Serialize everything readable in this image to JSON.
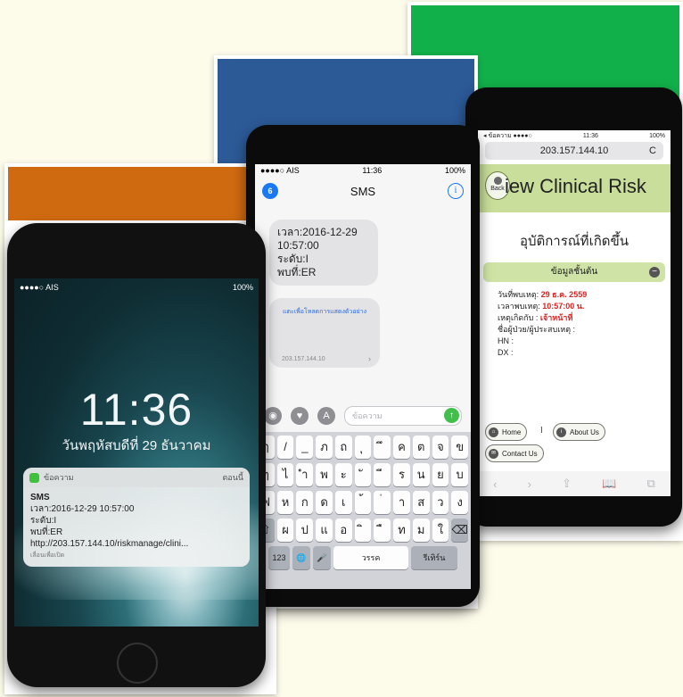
{
  "lock_phone": {
    "status": {
      "carrier": "●●●●○ AIS",
      "battery": "100%"
    },
    "time": "11:36",
    "date": "วันพฤหัสบดีที่ 29 ธันวาคม",
    "notification": {
      "app": "ข้อความ",
      "when": "ตอนนี้",
      "title": "SMS",
      "lines": [
        "เวลา:2016-12-29 10:57:00",
        "ระดับ:I",
        "พบที่:ER",
        "http://203.157.144.10/riskmanage/clini..."
      ],
      "hint": "เลื่อนเพื่อเปิด"
    }
  },
  "sms_phone": {
    "status": {
      "carrier": "●●●●○ AIS",
      "time": "11:36",
      "battery": "100%"
    },
    "nav": {
      "back_count": "6",
      "title": "SMS",
      "info": "i"
    },
    "message_lines": [
      "เวลา:2016-12-29",
      "10:57:00",
      "ระดับ:I",
      "พบที่:ER"
    ],
    "link_preview": {
      "text": "แตะเพื่อโหลดการแสดงตัวอย่าง",
      "url": "203.157.144.10",
      "arrow": "›"
    },
    "input_placeholder": "ข้อความ",
    "keyboard": {
      "rows": [
        [
          "ๅ",
          "/",
          "_",
          "ภ",
          "ถ",
          "ุ",
          "ึ",
          "ค",
          "ต",
          "จ",
          "ข",
          "ช"
        ],
        [
          "ๆ",
          "ไ",
          "ำ",
          "พ",
          "ะ",
          "ั",
          "ี",
          "ร",
          "น",
          "ย",
          "บ",
          "ล"
        ],
        [
          "ฟ",
          "ห",
          "ก",
          "ด",
          "เ",
          "้",
          "่",
          "า",
          "ส",
          "ว",
          "ง",
          "ข"
        ],
        [
          "⇧",
          "ผ",
          "ป",
          "แ",
          "อ",
          "ิ",
          "ื",
          "ท",
          "ม",
          "ใ",
          "ฝ",
          "⌫"
        ]
      ],
      "bottom": {
        "numbers": "123",
        "globe": "🌐",
        "mic": "🎤",
        "space": "วรรค",
        "return": "รีเทิร์น"
      }
    }
  },
  "web_phone": {
    "status": {
      "left": "◂ ข้อความ ●●●●○",
      "time": "11:36",
      "battery": "100%"
    },
    "address": "203.157.144.10",
    "reload": "C",
    "back_label": "Back",
    "header_title": "iew Clinical Risk",
    "heading": "อุบัติการณ์ที่เกิดขึ้น",
    "section_title": "ข้อมูลชั้นต้น",
    "minus": "−",
    "fields": [
      {
        "label": "วันที่พบเหตุ:",
        "value": "29 ธ.ค. 2559"
      },
      {
        "label": "เวลาพบเหตุ:",
        "value": "10:57:00 น."
      },
      {
        "label": "เหตุเกิดกับ :",
        "value": "เจ้าหน้าที่"
      },
      {
        "label": "ชื่อผู้ป่วย/ผู้ประสบเหตุ :",
        "value": ""
      },
      {
        "label": "HN :",
        "value": ""
      },
      {
        "label": "DX :",
        "value": ""
      }
    ],
    "nav": {
      "home": "Home",
      "separator": "I",
      "about": "About Us",
      "contact": "Contact Us"
    },
    "toolbar": [
      "‹",
      "›",
      "⇪",
      "📖",
      "⧉"
    ]
  },
  "colors": {
    "orange_band": "#cf6a10",
    "blue_band": "#2c5a97",
    "green_band": "#12b04a"
  }
}
